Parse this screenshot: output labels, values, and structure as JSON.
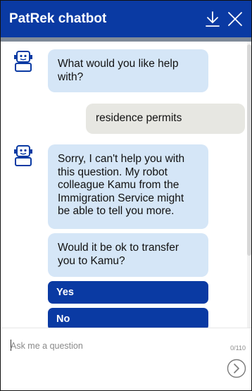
{
  "header": {
    "title": "PatRek chatbot",
    "minimize_icon": "download-arrow-icon",
    "close_icon": "close-icon"
  },
  "messages": [
    {
      "from": "bot",
      "text": "What would you like help with?"
    },
    {
      "from": "user",
      "text": "residence permits"
    },
    {
      "from": "bot",
      "text": "Sorry, I can't help you with this question. My robot colleague Kamu from the Immigration Service might be able to tell you more."
    },
    {
      "from": "bot",
      "text": "Would it be ok to transfer you to Kamu?"
    }
  ],
  "choices": {
    "yes": "Yes",
    "no": "No"
  },
  "composer": {
    "placeholder": "Ask me a question",
    "value": "",
    "counter": "0/110",
    "send_icon": "send-arrow-icon"
  },
  "colors": {
    "brand": "#0a3aa3",
    "bot_bubble": "#d5e6f7",
    "user_bubble": "#e7e7e2"
  }
}
